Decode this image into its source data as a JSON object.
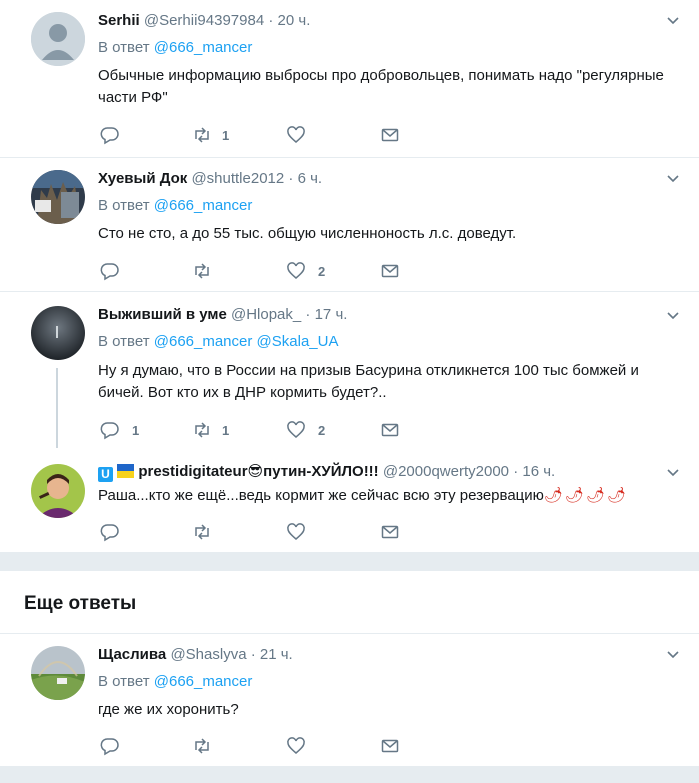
{
  "tweets": [
    {
      "name": "Serhii",
      "handle": "@Serhii94397984",
      "dot": "·",
      "time": "20 ч.",
      "reply_prefix": "В ответ",
      "reply_mentions": "@666_mancer",
      "text": "Обычные информацию выбросы про добровольцев, понимать надо \"регулярные части РФ\"",
      "replies": "",
      "retweets": "1",
      "likes": ""
    },
    {
      "name": "Хуевый Док",
      "handle": "@shuttle2012",
      "dot": "·",
      "time": "6 ч.",
      "reply_prefix": "В ответ",
      "reply_mentions": "@666_mancer",
      "text": "Сто не сто, а до 55 тыс. общую численноность л.с. доведут.",
      "replies": "",
      "retweets": "",
      "likes": "2"
    },
    {
      "name": "Выживший в уме",
      "handle": "@Hlopak_",
      "dot": "·",
      "time": "17 ч.",
      "reply_prefix": "В ответ",
      "reply_mentions": "@666_mancer @Skala_UA",
      "text": "Ну я думаю, что в России на призыв Басурина откликнется 100 тыс бомжей и бичей. Вот кто их в ДНР кормить будет?..",
      "replies": "1",
      "retweets": "1",
      "likes": "2"
    },
    {
      "name_u": "U",
      "name": "prestidigitateur",
      "name_emoji": "😎",
      "name_tail": "путин-ХУЙЛО!!!",
      "handle": "@2000qwerty2000",
      "dot": "·",
      "time": "16 ч.",
      "text": "Раша...кто же ещё...ведь кормит же сейчас всю эту резервацию",
      "text_emoji": "🌶🌶🌶🌶",
      "replies": "",
      "retweets": "",
      "likes": ""
    },
    {
      "name": "Щаслива",
      "handle": "@Shaslyva",
      "dot": "·",
      "time": "21 ч.",
      "reply_prefix": "В ответ",
      "reply_mentions": "@666_mancer",
      "text": "где же их хоронить?",
      "replies": "",
      "retweets": "",
      "likes": ""
    }
  ],
  "more_replies_title": "Еще ответы",
  "colors": {
    "accent": "#1da1f2",
    "muted": "#657786",
    "text": "#14171a",
    "divider": "#e6ecf0"
  },
  "icons": [
    "reply-icon",
    "retweet-icon",
    "like-icon",
    "message-icon",
    "chevron-down-icon"
  ]
}
